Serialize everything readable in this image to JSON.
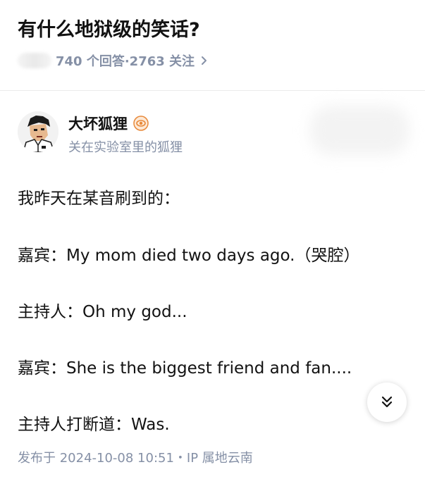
{
  "question": {
    "title": "有什么地狱级的笑话?",
    "stats": "740 个回答·2763 关注",
    "chevron_icon": "chevron-right-icon"
  },
  "author": {
    "name": "大坏狐狸",
    "bio": "关在实验室里的狐狸",
    "badge_icon": "creator-badge-icon",
    "badge_color": "#e8893a"
  },
  "answer": {
    "lines": [
      "我昨天在某音刷到的：",
      "嘉宾：My mom died two days ago.（哭腔）",
      "主持人：Oh my god...",
      "嘉宾：She is the biggest friend and fan....",
      "主持人打断道：Was."
    ]
  },
  "footer": {
    "published": "发布于 2024-10-08 10:51・IP 属地云南"
  },
  "controls": {
    "scroll_icon": "double-chevron-down-icon"
  },
  "colors": {
    "text": "#121212",
    "muted": "#8590a6",
    "divider": "#ebebeb"
  }
}
